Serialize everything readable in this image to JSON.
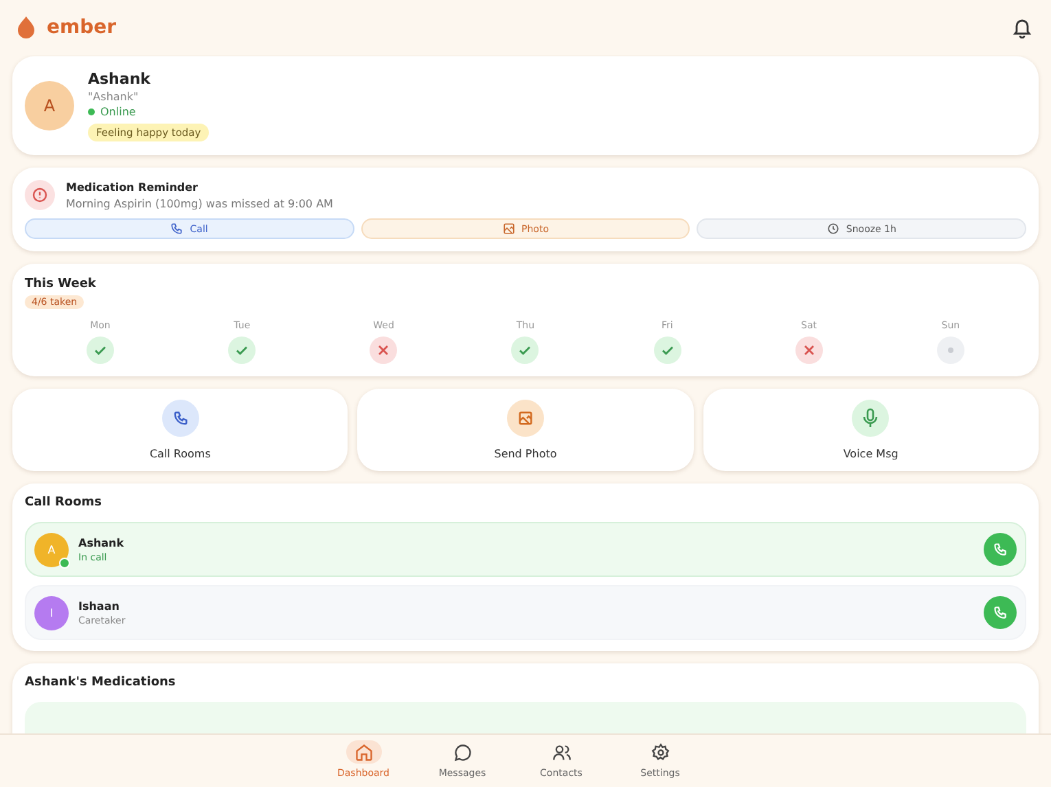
{
  "app": {
    "name": "ember"
  },
  "profile": {
    "initial": "A",
    "name": "Ashank",
    "nickname": "\"Ashank\"",
    "online": true,
    "status": "Online",
    "mood": "Feeling happy today"
  },
  "reminder": {
    "title": "Medication Reminder",
    "message": "Morning Aspirin (100mg) was missed at 9:00 AM",
    "actions": [
      {
        "kind": "call",
        "label": "Call"
      },
      {
        "kind": "photo",
        "label": "Photo"
      },
      {
        "kind": "snooze",
        "label": "Snooze 1h"
      }
    ]
  },
  "week": {
    "title": "This Week",
    "badge": "4/6 taken",
    "days": [
      {
        "label": "Mon",
        "kind": "taken"
      },
      {
        "label": "Tue",
        "kind": "taken"
      },
      {
        "label": "Wed",
        "kind": "missed"
      },
      {
        "label": "Thu",
        "kind": "taken"
      },
      {
        "label": "Fri",
        "kind": "taken"
      },
      {
        "label": "Sat",
        "kind": "missed"
      },
      {
        "label": "Sun",
        "kind": "pending"
      }
    ]
  },
  "quick_actions": [
    {
      "kind": "call",
      "label": "Call Rooms"
    },
    {
      "kind": "photo",
      "label": "Send Photo"
    },
    {
      "kind": "voice",
      "label": "Voice Msg"
    }
  ],
  "call_rooms": {
    "title": "Call Rooms",
    "rows": [
      {
        "initial": "A",
        "name": "Ashank",
        "subtitle": "In call",
        "in_call": true,
        "color": "#f0b429"
      },
      {
        "initial": "I",
        "name": "Ishaan",
        "subtitle": "Caretaker",
        "in_call": false,
        "color": "#b57bf0"
      }
    ]
  },
  "medications": {
    "title": "Ashank's Medications"
  },
  "nav": [
    {
      "kind": "home",
      "label": "Dashboard",
      "selected": true
    },
    {
      "kind": "messages",
      "label": "Messages",
      "selected": false
    },
    {
      "kind": "contacts",
      "label": "Contacts",
      "selected": false
    },
    {
      "kind": "settings",
      "label": "Settings",
      "selected": false
    }
  ]
}
